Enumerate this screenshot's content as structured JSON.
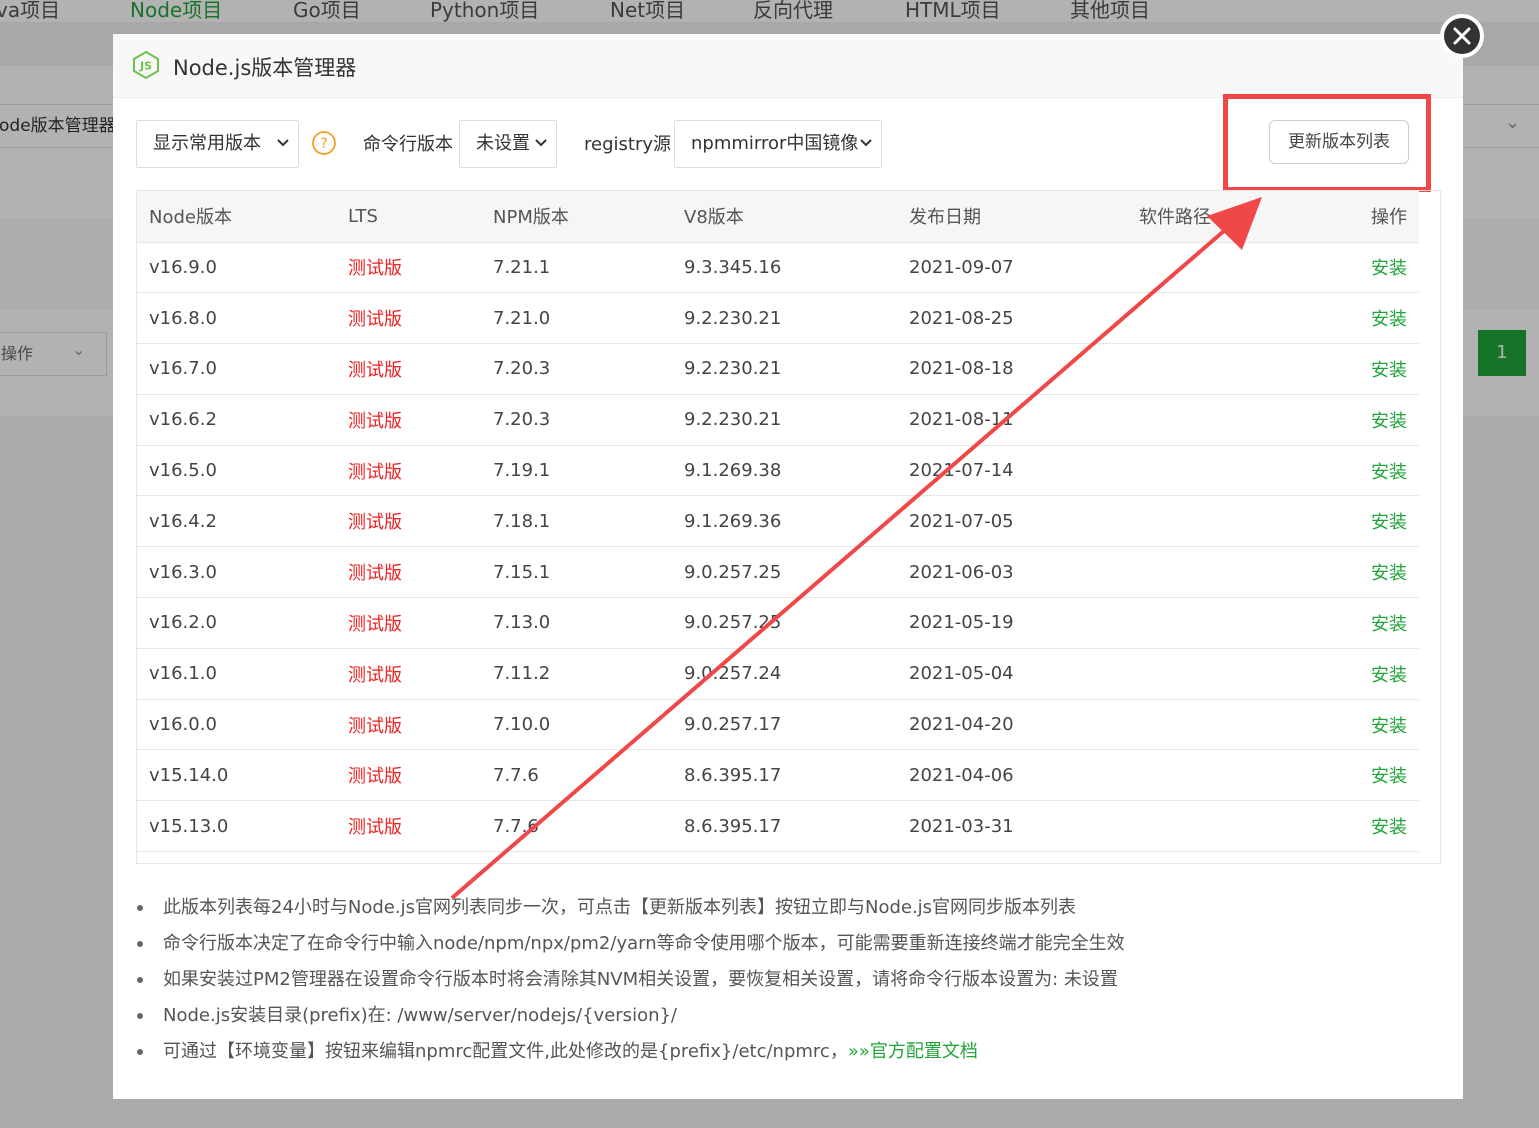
{
  "background": {
    "tabs": [
      "va项目",
      "Node项目",
      "Go项目",
      "Python项目",
      "Net项目",
      "反向代理",
      "HTML项目",
      "其他项目"
    ],
    "active_tab": 1,
    "left_select": "ode版本管理器",
    "action_select": "操作",
    "page_number": "1"
  },
  "modal": {
    "title": "Node.js版本管理器",
    "filter_select": "显示常用版本",
    "cli_label": "命令行版本",
    "cli_value": "未设置",
    "registry_label": "registry源",
    "registry_value": "npmmirror中国镜像",
    "refresh_button": "更新版本列表"
  },
  "table": {
    "headers": [
      "Node版本",
      "LTS",
      "NPM版本",
      "V8版本",
      "发布日期",
      "软件路径",
      "操作"
    ],
    "rows": [
      [
        "v16.9.0",
        "测试版",
        "7.21.1",
        "9.3.345.16",
        "2021-09-07",
        "",
        "安装"
      ],
      [
        "v16.8.0",
        "测试版",
        "7.21.0",
        "9.2.230.21",
        "2021-08-25",
        "",
        "安装"
      ],
      [
        "v16.7.0",
        "测试版",
        "7.20.3",
        "9.2.230.21",
        "2021-08-18",
        "",
        "安装"
      ],
      [
        "v16.6.2",
        "测试版",
        "7.20.3",
        "9.2.230.21",
        "2021-08-11",
        "",
        "安装"
      ],
      [
        "v16.5.0",
        "测试版",
        "7.19.1",
        "9.1.269.38",
        "2021-07-14",
        "",
        "安装"
      ],
      [
        "v16.4.2",
        "测试版",
        "7.18.1",
        "9.1.269.36",
        "2021-07-05",
        "",
        "安装"
      ],
      [
        "v16.3.0",
        "测试版",
        "7.15.1",
        "9.0.257.25",
        "2021-06-03",
        "",
        "安装"
      ],
      [
        "v16.2.0",
        "测试版",
        "7.13.0",
        "9.0.257.25",
        "2021-05-19",
        "",
        "安装"
      ],
      [
        "v16.1.0",
        "测试版",
        "7.11.2",
        "9.0.257.24",
        "2021-05-04",
        "",
        "安装"
      ],
      [
        "v16.0.0",
        "测试版",
        "7.10.0",
        "9.0.257.17",
        "2021-04-20",
        "",
        "安装"
      ],
      [
        "v15.14.0",
        "测试版",
        "7.7.6",
        "8.6.395.17",
        "2021-04-06",
        "",
        "安装"
      ],
      [
        "v15.13.0",
        "测试版",
        "7.7.6",
        "8.6.395.17",
        "2021-03-31",
        "",
        "安装"
      ]
    ]
  },
  "notes": [
    "此版本列表每24小时与Node.js官网列表同步一次，可点击【更新版本列表】按钮立即与Node.js官网同步版本列表",
    "命令行版本决定了在命令行中输入node/npm/npx/pm2/yarn等命令使用哪个版本，可能需要重新连接终端才能完全生效",
    "如果安装过PM2管理器在设置命令行版本时将会清除其NVM相关设置，要恢复相关设置，请将命令行版本设置为: 未设置",
    "Node.js安装目录(prefix)在: /www/server/nodejs/{version}/",
    "可通过【环境变量】按钮来编辑npmrc配置文件,此处修改的是{prefix}/etc/npmrc，"
  ],
  "docs_link": "»»官方配置文档",
  "colors": {
    "accent_green": "#20a53a",
    "lts_red": "#ee2222",
    "annotation_red": "#f04848"
  }
}
